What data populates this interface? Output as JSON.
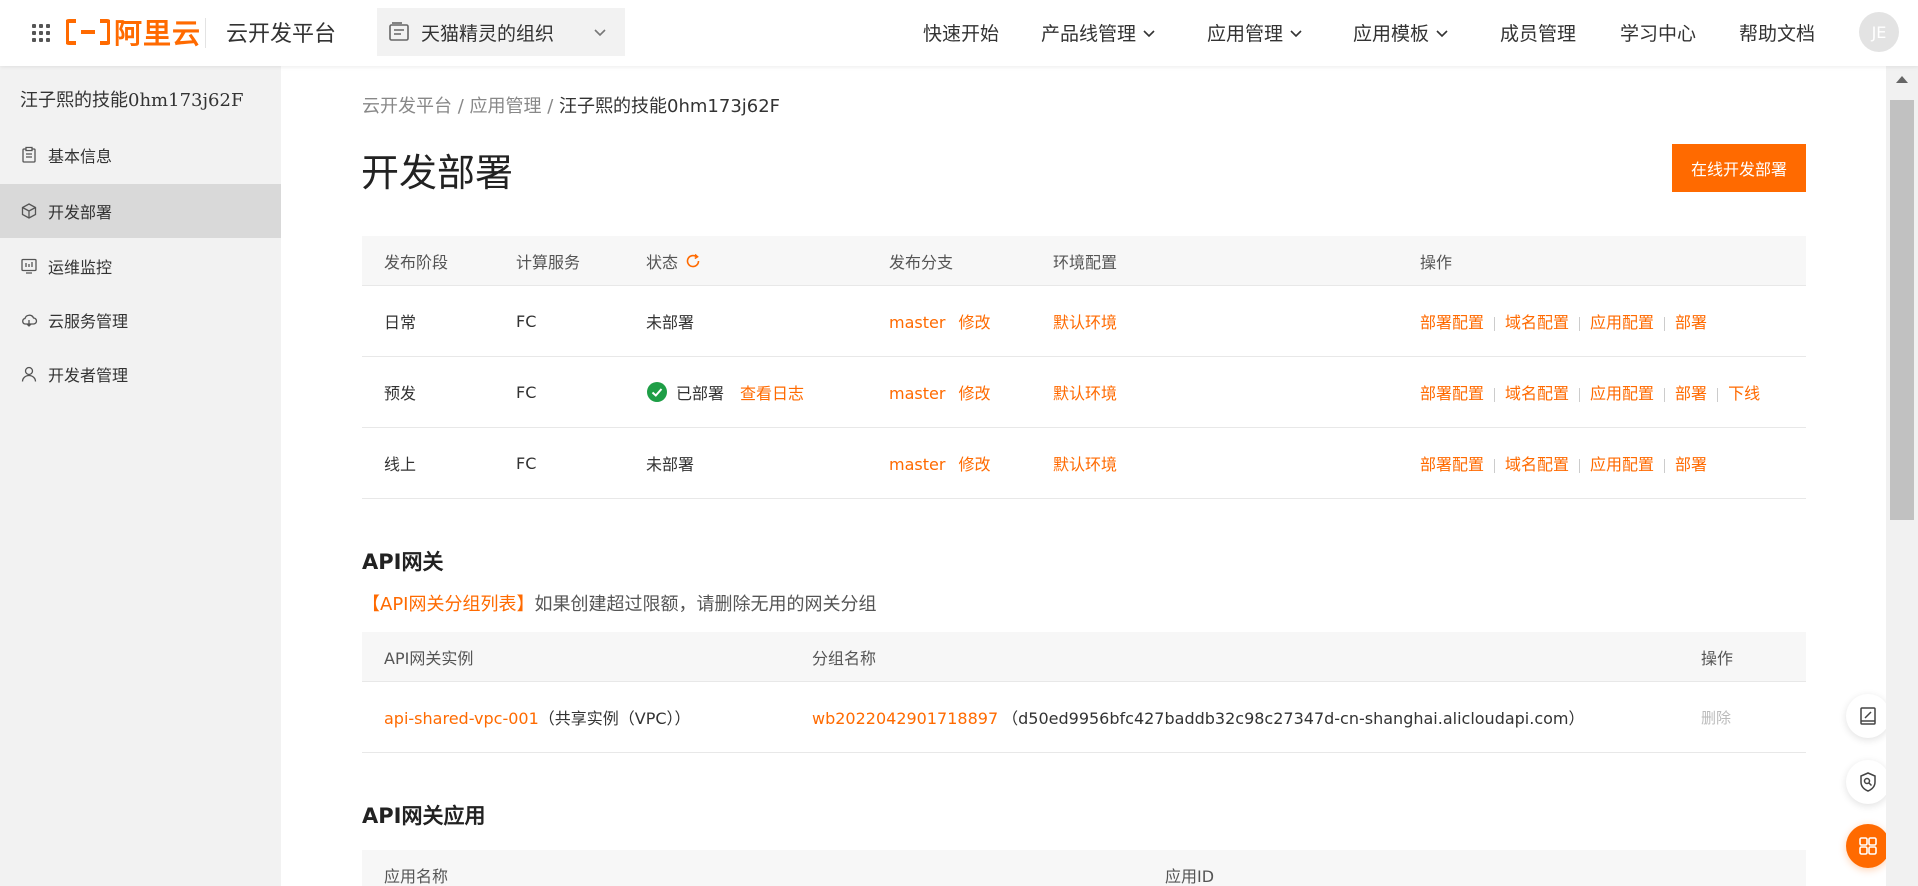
{
  "header": {
    "brand_text": "阿里云",
    "app_title": "云开发平台",
    "org_select": "天猫精灵的组织",
    "nav": [
      {
        "label": "快速开始"
      },
      {
        "label": "产品线管理"
      },
      {
        "label": "应用管理"
      },
      {
        "label": "应用模板"
      },
      {
        "label": "成员管理"
      },
      {
        "label": "学习中心"
      },
      {
        "label": "帮助文档"
      }
    ],
    "avatar": "JE"
  },
  "sidebar": {
    "title": "汪子熙的技能0hm173j62F",
    "items": [
      {
        "label": "基本信息",
        "icon": "clipboard-icon"
      },
      {
        "label": "开发部署",
        "icon": "cube-icon"
      },
      {
        "label": "运维监控",
        "icon": "monitor-icon"
      },
      {
        "label": "云服务管理",
        "icon": "cloud-icon"
      },
      {
        "label": "开发者管理",
        "icon": "user-icon"
      }
    ]
  },
  "breadcrumb": {
    "items": [
      "云开发平台",
      "应用管理"
    ],
    "separator": " / ",
    "current": "汪子熙的技能0hm173j62F"
  },
  "page_title": "开发部署",
  "primary_button": "在线开发部署",
  "deploy_table": {
    "headers": [
      "发布阶段",
      "计算服务",
      "状态",
      "发布分支",
      "环境配置",
      "操作"
    ],
    "rows": [
      {
        "stage": "日常",
        "service": "FC",
        "status": "未部署",
        "branch": "master",
        "edit": "修改",
        "env": "默认环境",
        "ops": [
          "部署配置",
          "域名配置",
          "应用配置",
          "部署"
        ]
      },
      {
        "stage": "预发",
        "service": "FC",
        "status": "已部署",
        "log": "查看日志",
        "branch": "master",
        "edit": "修改",
        "env": "默认环境",
        "ops": [
          "部署配置",
          "域名配置",
          "应用配置",
          "部署",
          "下线"
        ]
      },
      {
        "stage": "线上",
        "service": "FC",
        "status": "未部署",
        "branch": "master",
        "edit": "修改",
        "env": "默认环境",
        "ops": [
          "部署配置",
          "域名配置",
          "应用配置",
          "部署"
        ]
      }
    ]
  },
  "api_gateway": {
    "title": "API网关",
    "hint_link": "【API网关分组列表】",
    "hint_text": "如果创建超过限额，请删除无用的网关分组",
    "headers": [
      "API网关实例",
      "分组名称",
      "操作"
    ],
    "rows": [
      {
        "instance": "api-shared-vpc-001",
        "instance_note": "（共享实例（VPC））",
        "group": "wb2022042901718897",
        "group_domain": "（d50ed9956bfc427baddb32c98c27347d-cn-shanghai.alicloudapi.com）",
        "op": "删除"
      }
    ]
  },
  "api_apps": {
    "title": "API网关应用",
    "headers": [
      "应用名称",
      "应用ID"
    ]
  },
  "colors": {
    "accent": "#ff6a00",
    "success": "#1e9e46"
  }
}
